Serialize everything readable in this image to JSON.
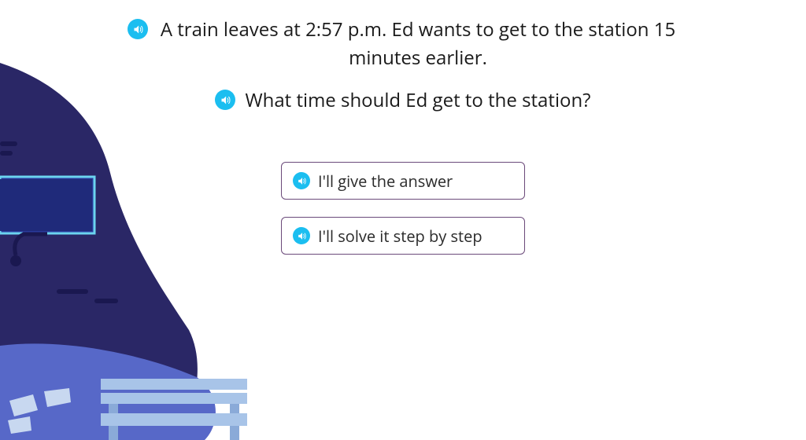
{
  "prompt1": "A train leaves at 2:57 p.m. Ed wants to get to the station 15 minutes earlier.",
  "prompt2": "What time should Ed get to the station?",
  "options": {
    "answer": "I'll give the answer",
    "step": "I'll solve it step by step"
  },
  "colors": {
    "accent": "#1bbef0",
    "border": "#6b4a7a",
    "darkblue": "#2a2766",
    "midblue": "#3a3aa8",
    "lightblue": "#a8c4e8"
  }
}
